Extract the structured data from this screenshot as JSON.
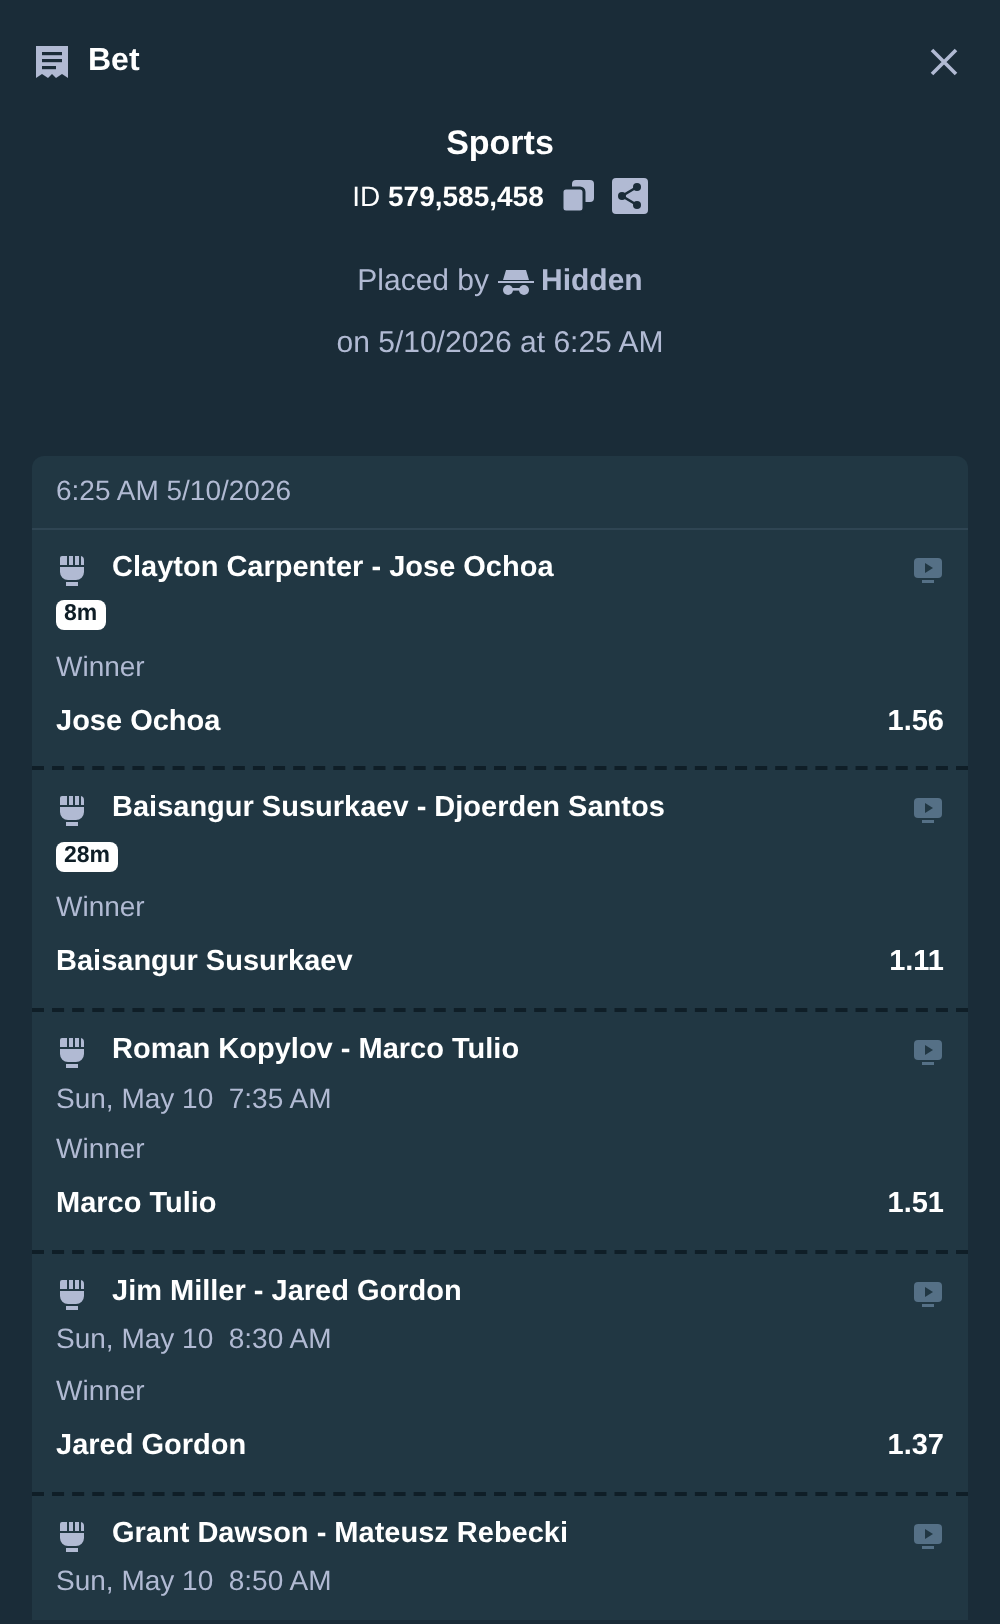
{
  "header": {
    "title": "Bet"
  },
  "summary": {
    "title": "Sports",
    "id_label": "ID",
    "id_value": "579,585,458",
    "placed_by_label": "Placed by",
    "placed_by": "Hidden",
    "placed_on": "on 5/10/2026 at 6:25 AM"
  },
  "card": {
    "timestamp": "6:25 AM 5/10/2026",
    "events": [
      {
        "match": "Clayton Carpenter - Jose Ochoa",
        "kind": "live",
        "badge": "8m",
        "market": "Winner",
        "selection": "Jose Ochoa",
        "odds": "1.56"
      },
      {
        "match": "Baisangur Susurkaev - Djoerden Santos",
        "kind": "live",
        "badge": "28m",
        "market": "Winner",
        "selection": "Baisangur Susurkaev",
        "odds": "1.11"
      },
      {
        "match": "Roman Kopylov - Marco Tulio",
        "kind": "scheduled",
        "time": "Sun, May 10  7:35 AM",
        "market": "Winner",
        "selection": "Marco Tulio",
        "odds": "1.51"
      },
      {
        "match": "Jim Miller - Jared Gordon",
        "kind": "scheduled",
        "time": "Sun, May 10  8:30 AM",
        "market": "Winner",
        "selection": "Jared Gordon",
        "odds": "1.37"
      },
      {
        "match": "Grant Dawson - Mateusz Rebecki",
        "kind": "scheduled",
        "time": "Sun, May 10  8:50 AM"
      }
    ]
  }
}
